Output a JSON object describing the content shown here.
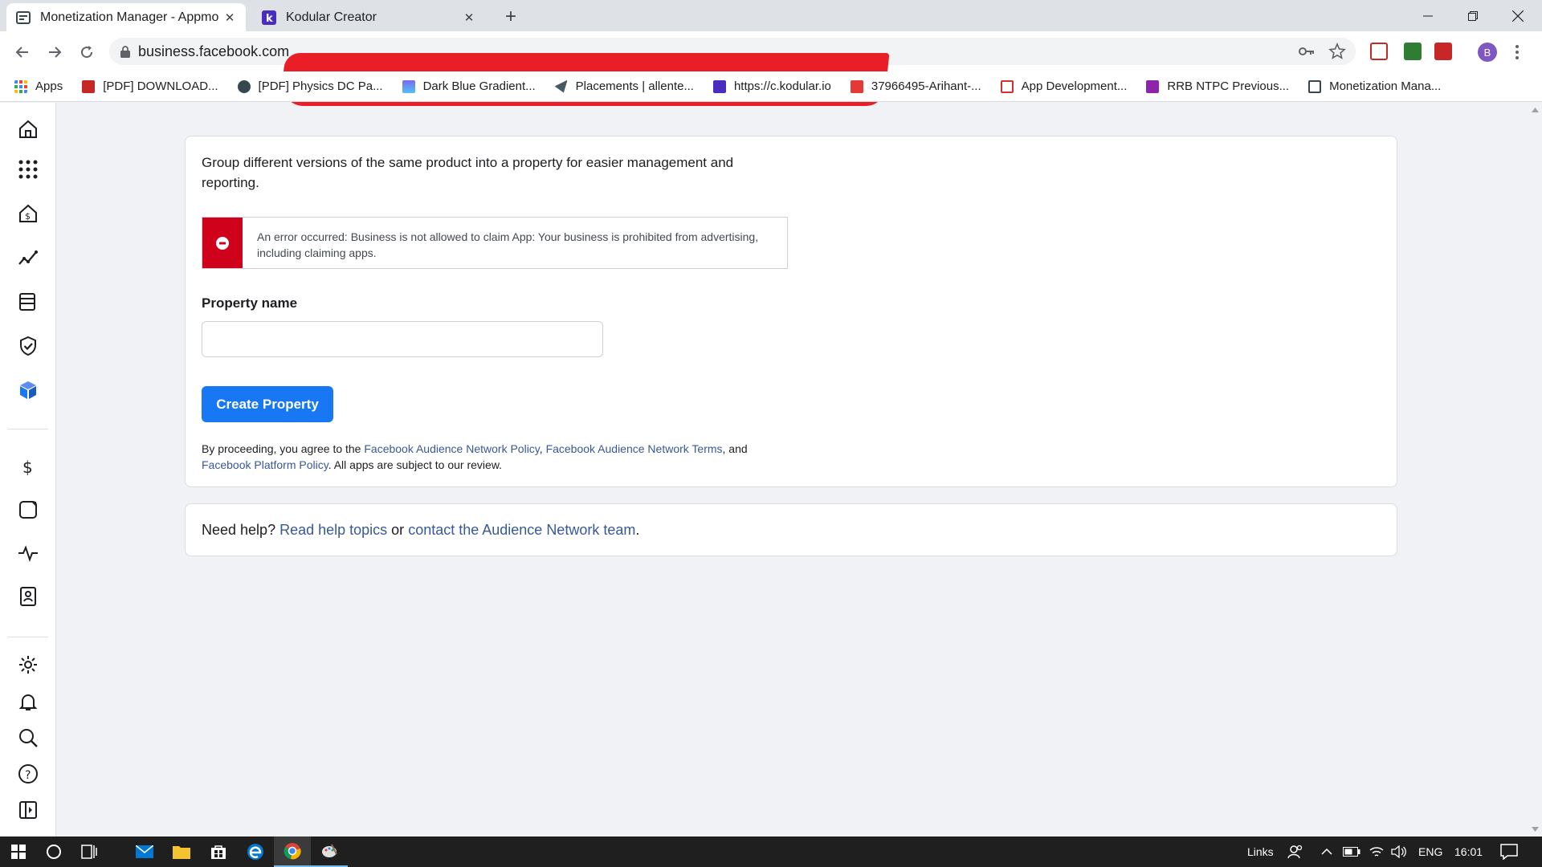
{
  "browser": {
    "tabs": [
      {
        "title": "Monetization Manager - Appmo"
      },
      {
        "title": "Kodular Creator"
      }
    ],
    "url": "business.facebook.com",
    "bookmarks": [
      {
        "label": "Apps",
        "color": "#4285f4"
      },
      {
        "label": "[PDF] DOWNLOAD...",
        "color": "#c62828"
      },
      {
        "label": "[PDF] Physics DC Pa...",
        "color": "#37474f"
      },
      {
        "label": "Dark Blue Gradient...",
        "color": "#7b68ee"
      },
      {
        "label": "Placements | allente...",
        "color": "#455a64"
      },
      {
        "label": "https://c.kodular.io",
        "color": "#4a2dbf"
      },
      {
        "label": "37966495-Arihant-...",
        "color": "#e53935"
      },
      {
        "label": "App Development...",
        "color": "#d32f2f"
      },
      {
        "label": "RRB NTPC Previous...",
        "color": "#8e24aa"
      },
      {
        "label": "Monetization Mana...",
        "color": "#37474f"
      }
    ],
    "profile_initial": "B"
  },
  "sidebar": {
    "icons": [
      "home-icon",
      "apps-grid-icon",
      "monetization-home-icon",
      "trend-icon",
      "database-icon",
      "shield-check-icon",
      "property-cube-icon",
      "dollar-icon",
      "square-icon",
      "pulse-icon",
      "contact-book-icon",
      "gear-icon",
      "bell-icon",
      "search-icon",
      "help-icon",
      "collapse-panel-icon"
    ]
  },
  "main": {
    "description": "Group different versions of the same product into a property for easier management and reporting.",
    "error_message": "An error occurred: Business is not allowed to claim App: Your business is prohibited from advertising, including claiming apps.",
    "property_label": "Property name",
    "property_value": "",
    "create_button": "Create Property",
    "legal": {
      "prefix": "By proceeding, you agree to the ",
      "link1": "Facebook Audience Network Policy",
      "sep1": ", ",
      "link2": "Facebook Audience Network Terms",
      "sep2": ", and",
      "link3": "Facebook Platform Policy",
      "suffix": ". All apps are subject to our review."
    },
    "help": {
      "prefix": "Need help? ",
      "link1": "Read help topics",
      "middle": " or ",
      "link2": "contact the Audience Network team",
      "suffix": "."
    }
  },
  "taskbar": {
    "links_label": "Links",
    "language": "ENG",
    "time": "16:01"
  },
  "colors": {
    "accent": "#1877f2",
    "error": "#d0021b",
    "link": "#385898"
  }
}
